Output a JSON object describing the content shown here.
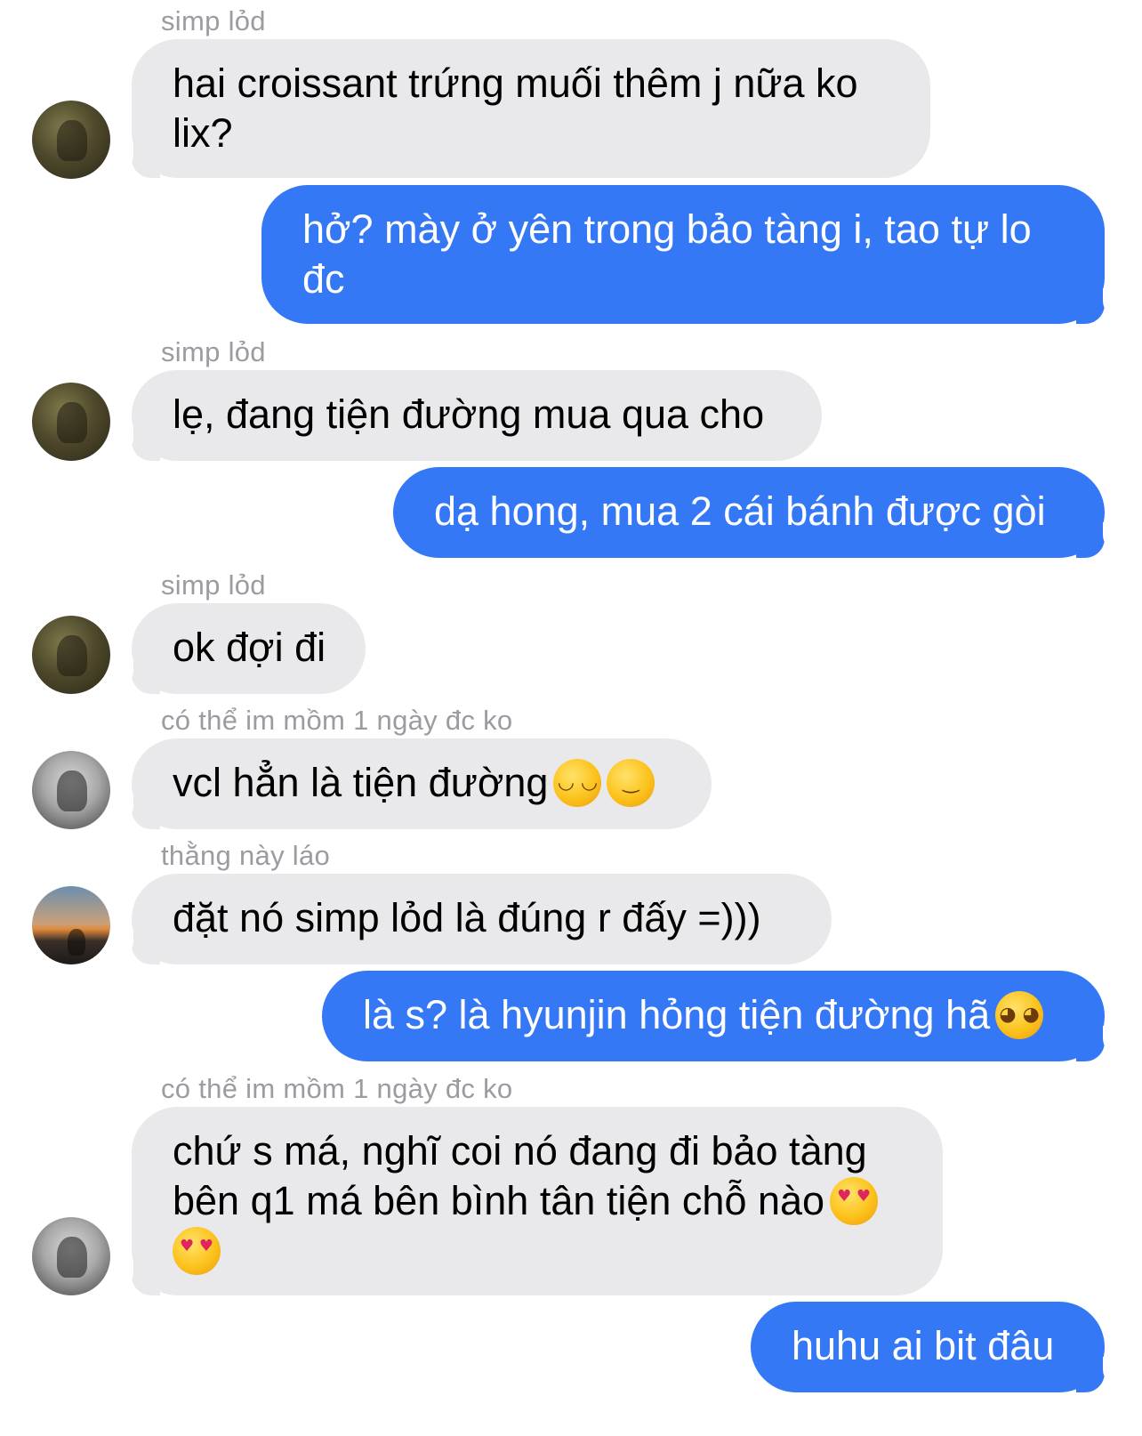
{
  "messages": [
    {
      "sender": "simp lỏd",
      "text": "hai croissant trứng muối thêm j nữa ko lix?",
      "direction": "in",
      "avatar": "avatar-green-icon"
    },
    {
      "text": "hở? mày ở yên trong bảo tàng i, tao tự lo đc",
      "direction": "out"
    },
    {
      "sender": "simp lỏd",
      "text": "lẹ, đang tiện đường mua qua cho",
      "direction": "in",
      "avatar": "avatar-green-icon"
    },
    {
      "text": "dạ hong, mua 2 cái bánh được gòi",
      "direction": "out"
    },
    {
      "sender": "simp lỏd",
      "text": "ok đợi đi",
      "direction": "in",
      "avatar": "avatar-green-icon"
    },
    {
      "sender": "có thể im mồm 1 ngày đc ko",
      "text": "vcl hẳn là tiện đường",
      "emoji": [
        "smiling-face-icon",
        "smirking-face-icon"
      ],
      "direction": "in",
      "avatar": "avatar-gray-icon"
    },
    {
      "sender": "thằng này láo",
      "text": "đặt nó simp lỏd là đúng r đấy =)))",
      "direction": "in",
      "avatar": "avatar-sunset-icon"
    },
    {
      "text": "là s? là hyunjin hỏng tiện đường hã",
      "emoji": [
        "pleading-face-icon"
      ],
      "direction": "out"
    },
    {
      "sender": "có thể im mồm 1 ngày đc ko",
      "text": "chứ s má, nghĩ coi nó đang đi bảo tàng bên q1 má bên bình tân tiện chỗ nào",
      "emoji": [
        "heart-eyes-face-icon",
        "heart-eyes-face-icon"
      ],
      "direction": "in",
      "avatar": "avatar-gray-icon"
    },
    {
      "text": "huhu ai bit đâu",
      "direction": "out"
    }
  ],
  "colors": {
    "incoming_bubble": "#e9e9eb",
    "outgoing_bubble": "#3478f6",
    "sender_name": "#9b9ba1"
  }
}
